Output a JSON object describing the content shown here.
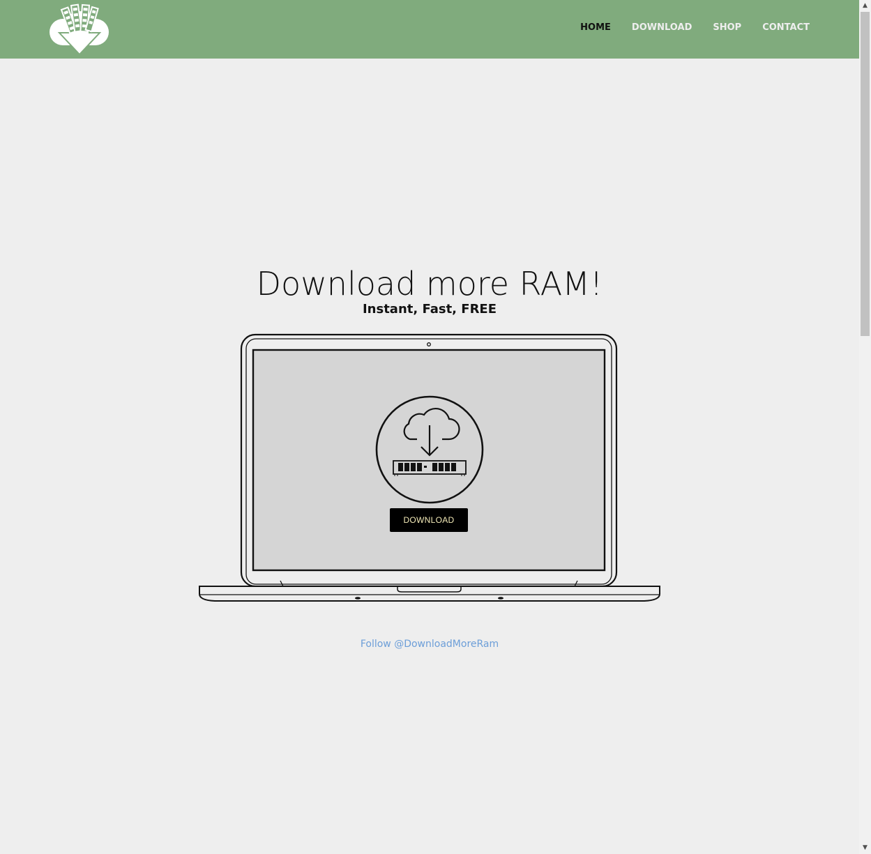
{
  "nav": {
    "items": [
      {
        "label": "HOME",
        "active": true
      },
      {
        "label": "DOWNLOAD",
        "active": false
      },
      {
        "label": "SHOP",
        "active": false
      },
      {
        "label": "CONTACT",
        "active": false
      }
    ]
  },
  "hero": {
    "title": "Download more RAM!",
    "subtitle": "Instant, Fast, FREE"
  },
  "laptop_screen": {
    "button_label": "DOWNLOAD"
  },
  "footer": {
    "follow_text": "Follow @DownloadMoreRam"
  },
  "colors": {
    "header_bg": "#80ab7d",
    "page_bg": "#eeeeee",
    "link": "#6c9ed8",
    "nav_active": "#111111",
    "nav_inactive": "#eeeeee"
  },
  "icons": {
    "logo": "cloud-download-ram-logo-icon",
    "screen": "cloud-download-ram-icon"
  }
}
